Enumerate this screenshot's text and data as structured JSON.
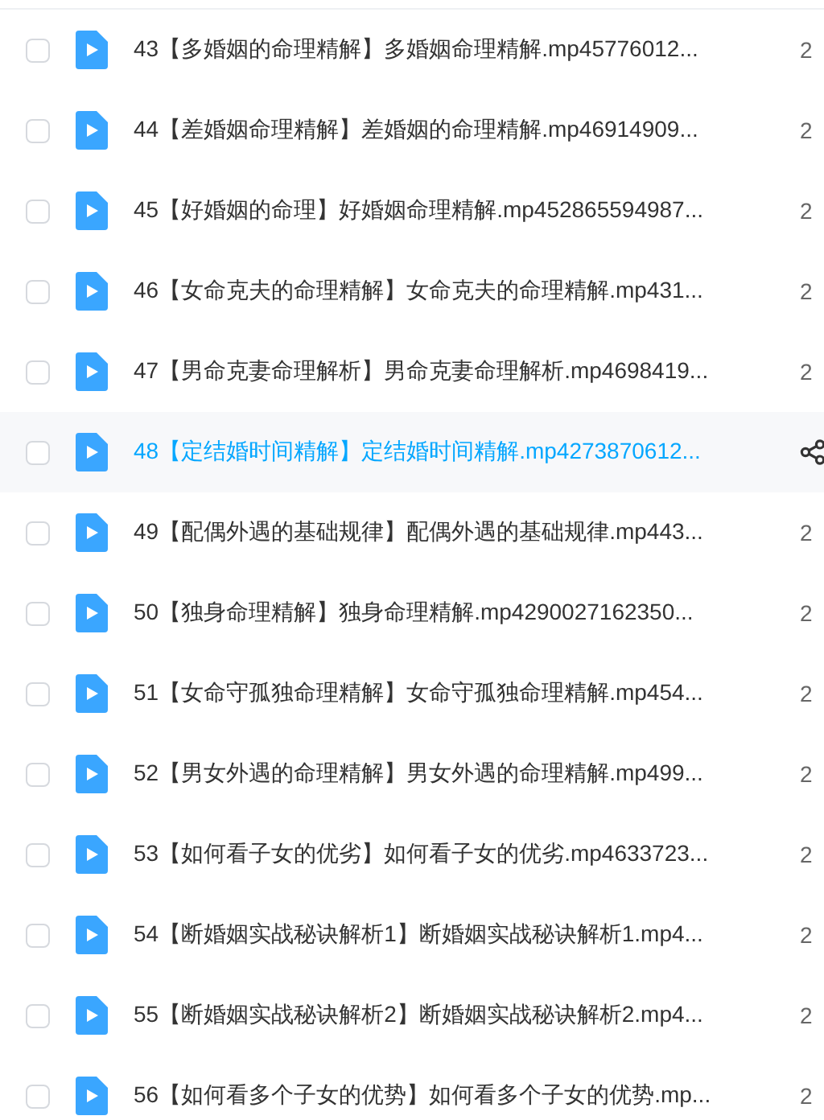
{
  "files": [
    {
      "name": "43【多婚姻的命理精解】多婚姻命理精解.mp45776012...",
      "date": "2",
      "checked": false,
      "highlighted": false
    },
    {
      "name": "44【差婚姻命理精解】差婚姻的命理精解.mp46914909...",
      "date": "2",
      "checked": false,
      "highlighted": false
    },
    {
      "name": "45【好婚姻的命理】好婚姻命理精解.mp452865594987...",
      "date": "2",
      "checked": false,
      "highlighted": false
    },
    {
      "name": "46【女命克夫的命理精解】女命克夫的命理精解.mp431...",
      "date": "2",
      "checked": false,
      "highlighted": false
    },
    {
      "name": "47【男命克妻命理解析】男命克妻命理解析.mp4698419...",
      "date": "2",
      "checked": false,
      "highlighted": false
    },
    {
      "name": "48【定结婚时间精解】定结婚时间精解.mp4273870612...",
      "checked": false,
      "highlighted": true
    },
    {
      "name": "49【配偶外遇的基础规律】配偶外遇的基础规律.mp443...",
      "date": "2",
      "checked": false,
      "highlighted": false
    },
    {
      "name": "50【独身命理精解】独身命理精解.mp4290027162350...",
      "date": "2",
      "checked": false,
      "highlighted": false
    },
    {
      "name": "51【女命守孤独命理精解】女命守孤独命理精解.mp454...",
      "date": "2",
      "checked": false,
      "highlighted": false
    },
    {
      "name": "52【男女外遇的命理精解】男女外遇的命理精解.mp499...",
      "date": "2",
      "checked": false,
      "highlighted": false
    },
    {
      "name": "53【如何看子女的优劣】如何看子女的优劣.mp4633723...",
      "date": "2",
      "checked": false,
      "highlighted": false
    },
    {
      "name": "54【断婚姻实战秘诀解析1】断婚姻实战秘诀解析1.mp4...",
      "date": "2",
      "checked": false,
      "highlighted": false
    },
    {
      "name": "55【断婚姻实战秘诀解析2】断婚姻实战秘诀解析2.mp4...",
      "date": "2",
      "checked": false,
      "highlighted": false
    },
    {
      "name": "56【如何看多个子女的优势】如何看多个子女的优势.mp...",
      "date": "2",
      "checked": false,
      "highlighted": false
    }
  ]
}
